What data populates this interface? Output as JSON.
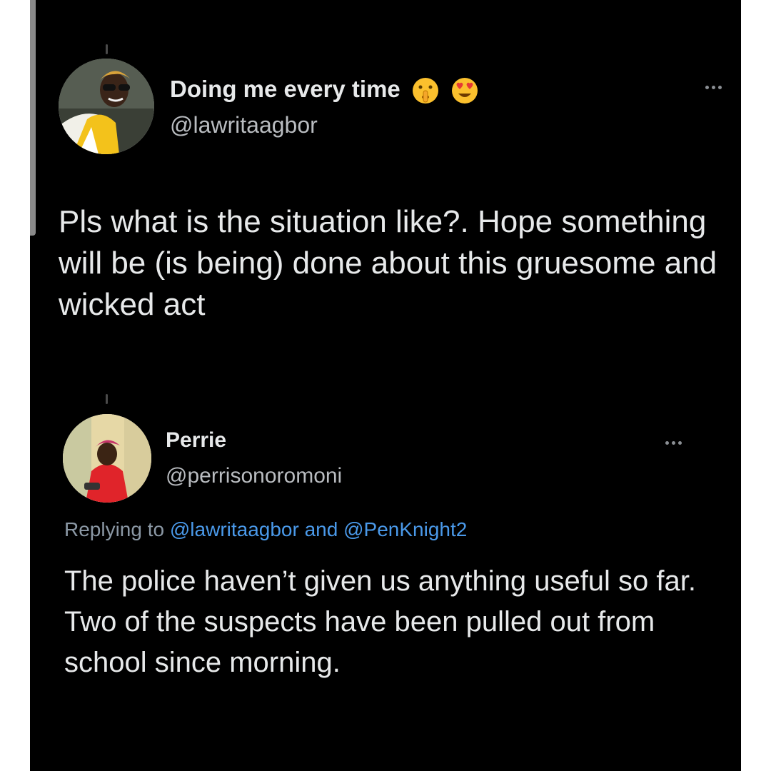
{
  "tweet1": {
    "display_name": "Doing me every time",
    "handle": "@lawritaagbor",
    "emojis": [
      "shushing-face-emoji",
      "heart-eyes-emoji"
    ],
    "body": "Pls what is the situation like?. Hope something will be (is being) done about this gruesome and wicked act"
  },
  "tweet2": {
    "display_name": "Perrie",
    "handle": "@perrisonoromoni",
    "replying_prefix": "Replying to ",
    "reply_mention_1": "@lawritaagbor",
    "reply_and": " and ",
    "reply_mention_2": "@PenKnight2",
    "body": "The police haven’t given us anything useful so far. Two of the suspects have been pulled out from school since morning."
  },
  "colors": {
    "background": "#000000",
    "text": "#e7e9ea",
    "secondary": "#8b98a5",
    "link": "#4a99e9"
  }
}
